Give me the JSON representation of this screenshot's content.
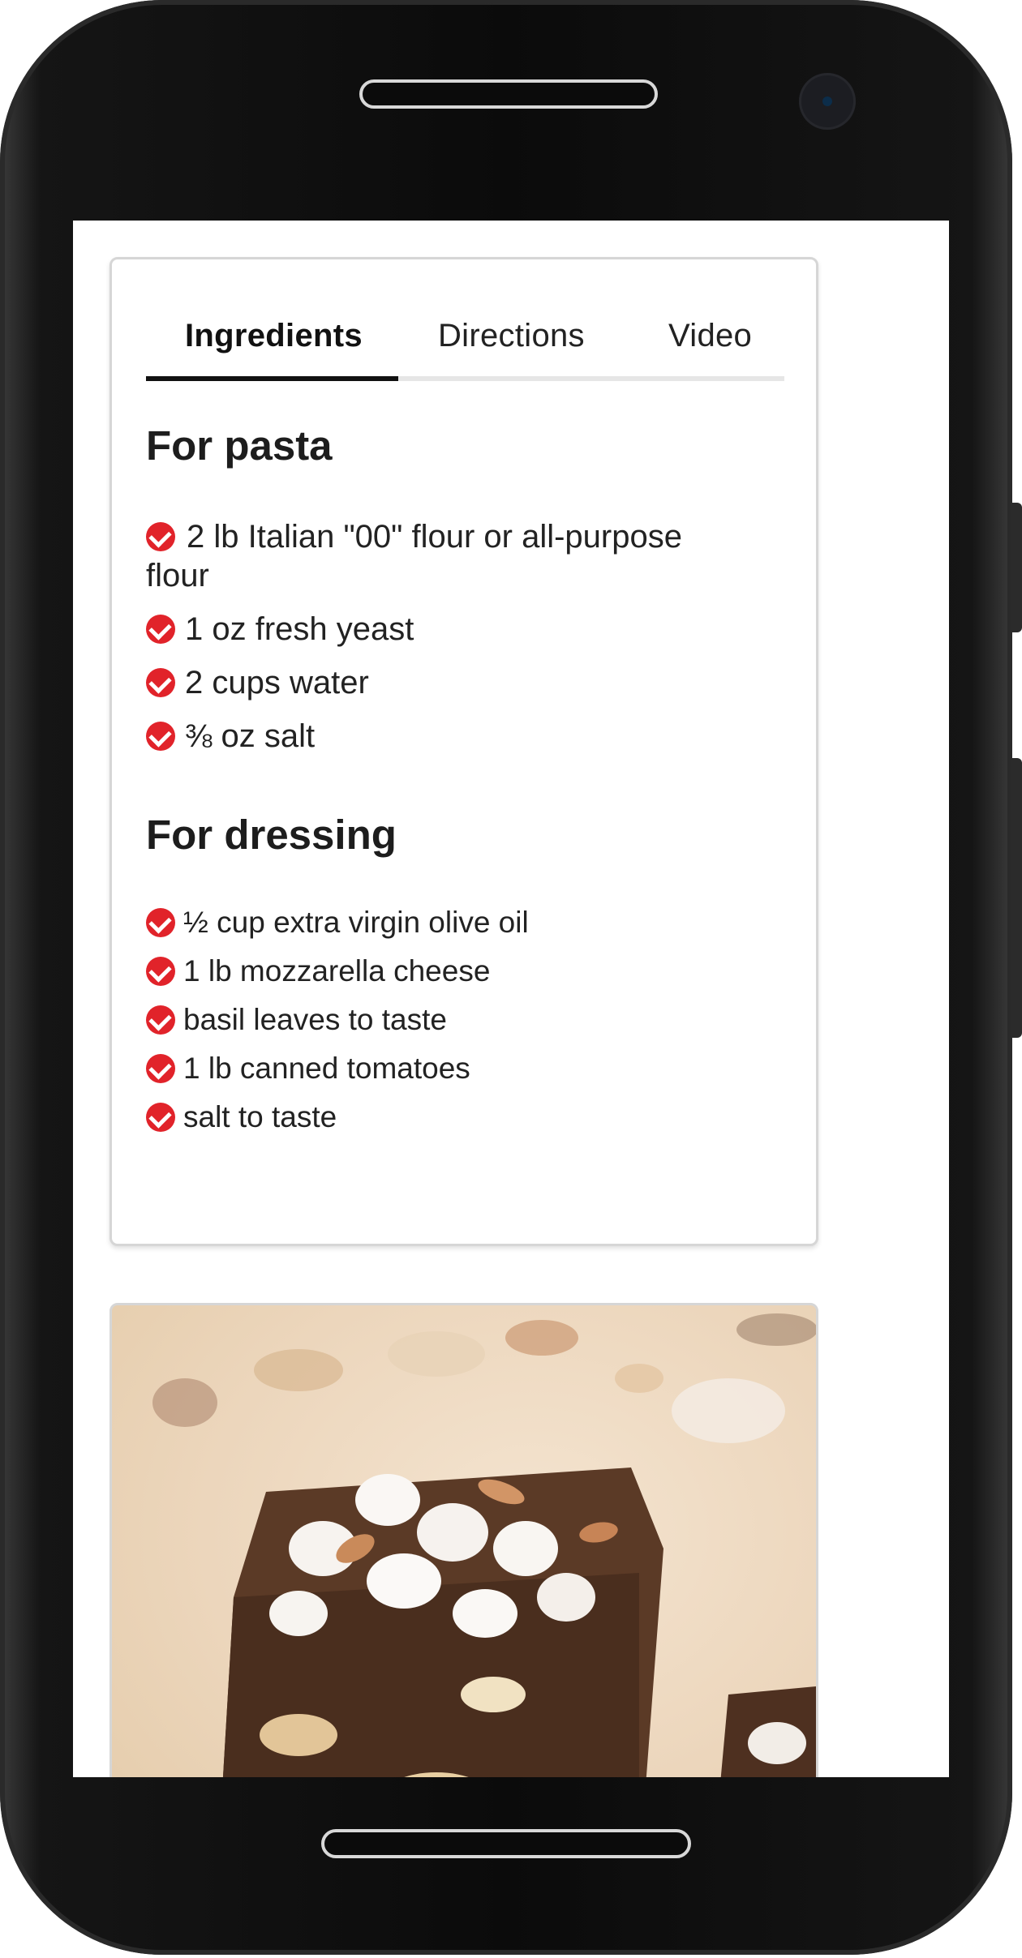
{
  "tabs": [
    {
      "label": "Ingredients",
      "active": true
    },
    {
      "label": "Directions",
      "active": false
    },
    {
      "label": "Video",
      "active": false
    }
  ],
  "sections": [
    {
      "title": "For pasta",
      "items": [
        "2 lb Italian \"00\" flour or all-purpose flour",
        "1 oz fresh yeast",
        "2 cups water",
        "⅜ oz salt"
      ]
    },
    {
      "title": "For dressing",
      "items": [
        "½ cup extra virgin olive oil",
        "1 lb mozzarella cheese",
        "basil leaves to taste",
        "1 lb canned tomatoes",
        "salt to taste"
      ]
    }
  ],
  "colors": {
    "accent": "#e1232a",
    "tab_active_underline": "#111111",
    "card_border": "#d6d6d6"
  },
  "icons": {
    "list_bullet": "check-circle-icon"
  }
}
